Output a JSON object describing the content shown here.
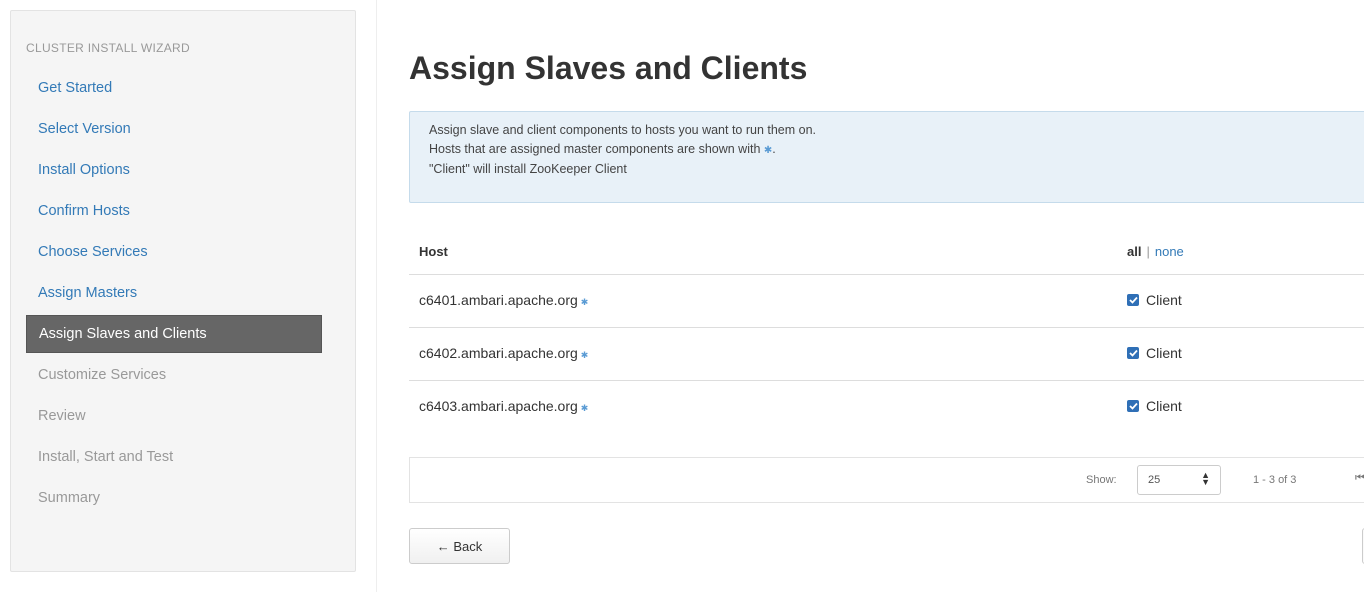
{
  "sidebar": {
    "heading": "CLUSTER INSTALL WIZARD",
    "items": [
      {
        "label": "Get Started",
        "state": "done"
      },
      {
        "label": "Select Version",
        "state": "done"
      },
      {
        "label": "Install Options",
        "state": "done"
      },
      {
        "label": "Confirm Hosts",
        "state": "done"
      },
      {
        "label": "Choose Services",
        "state": "done"
      },
      {
        "label": "Assign Masters",
        "state": "done"
      },
      {
        "label": "Assign Slaves and Clients",
        "state": "active"
      },
      {
        "label": "Customize Services",
        "state": "todo"
      },
      {
        "label": "Review",
        "state": "todo"
      },
      {
        "label": "Install, Start and Test",
        "state": "todo"
      },
      {
        "label": "Summary",
        "state": "todo"
      }
    ]
  },
  "main": {
    "title": "Assign Slaves and Clients",
    "alert": {
      "line1": "Assign slave and client components to hosts you want to run them on.",
      "line2_prefix": "Hosts that are assigned master components are shown with",
      "line2_suffix": ".",
      "line3": "\"Client\" will install ZooKeeper Client",
      "master_marker": "✱"
    },
    "table": {
      "host_header": "Host",
      "select_all": "all",
      "separator": "|",
      "select_none": "none",
      "rows": [
        {
          "host": "c6401.ambari.apache.org",
          "component": "Client",
          "checked": true
        },
        {
          "host": "c6402.ambari.apache.org",
          "component": "Client",
          "checked": true
        },
        {
          "host": "c6403.ambari.apache.org",
          "component": "Client",
          "checked": true
        }
      ]
    },
    "pager": {
      "show_label": "Show:",
      "page_size": "25",
      "range": "1 - 3 of 3",
      "first_icon": "⏮"
    },
    "back_label": "← Back"
  },
  "colors": {
    "link": "#337ab7",
    "active_nav": "#666666",
    "alert_bg": "#e8f1f8",
    "checkbox": "#2f6fb6"
  }
}
